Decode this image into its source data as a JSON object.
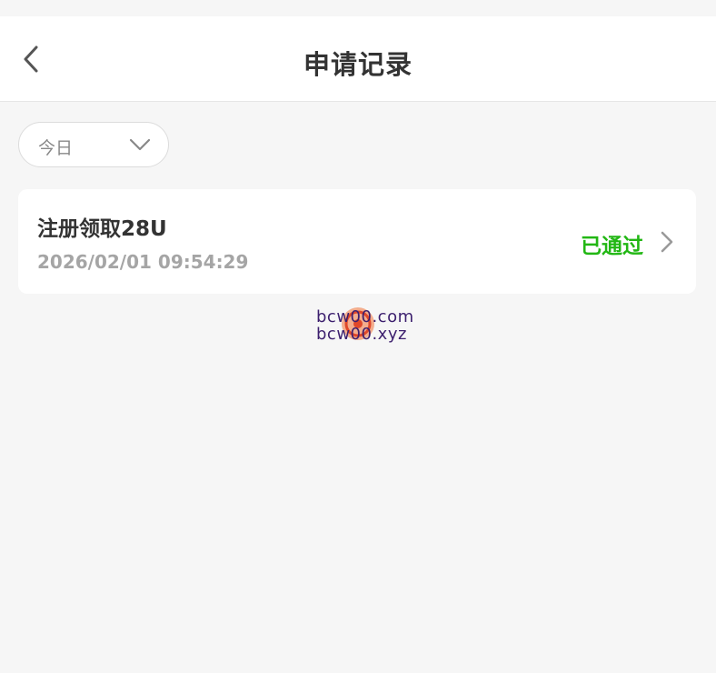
{
  "header": {
    "title": "申请记录",
    "back_icon": "chevron-left-icon"
  },
  "filter": {
    "selected": "今日",
    "icon": "chevron-down-icon"
  },
  "records": [
    {
      "title": "注册领取28U",
      "time": "2026/02/01 09:54:29",
      "status": "已通过",
      "status_color": "#22b714",
      "icon": "chevron-right-icon"
    }
  ],
  "watermark": {
    "line1": "bcw00.com",
    "line2": "bcw00.xyz"
  },
  "colors": {
    "background": "#f6f6f6",
    "card": "#ffffff",
    "title_text": "#333333",
    "muted_text": "#a5a5a5",
    "success": "#22b714"
  }
}
